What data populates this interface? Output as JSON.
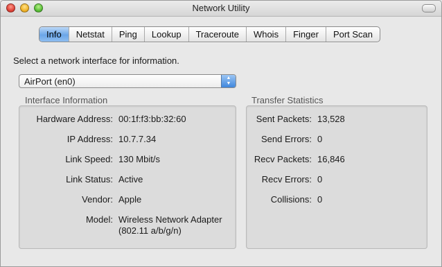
{
  "window": {
    "title": "Network Utility"
  },
  "tabs": [
    {
      "label": "Info",
      "active": true
    },
    {
      "label": "Netstat",
      "active": false
    },
    {
      "label": "Ping",
      "active": false
    },
    {
      "label": "Lookup",
      "active": false
    },
    {
      "label": "Traceroute",
      "active": false
    },
    {
      "label": "Whois",
      "active": false
    },
    {
      "label": "Finger",
      "active": false
    },
    {
      "label": "Port Scan",
      "active": false
    }
  ],
  "info": {
    "prompt": "Select a network interface for information.",
    "interface_select": {
      "value": "AirPort (en0)"
    },
    "interface_info": {
      "title": "Interface Information",
      "rows": [
        {
          "label": "Hardware Address:",
          "value": "00:1f:f3:bb:32:60"
        },
        {
          "label": "IP Address:",
          "value": "10.7.7.34"
        },
        {
          "label": "Link Speed:",
          "value": "130 Mbit/s"
        },
        {
          "label": "Link Status:",
          "value": "Active"
        },
        {
          "label": "Vendor:",
          "value": "Apple"
        },
        {
          "label": "Model:",
          "value": "Wireless Network Adapter",
          "value2": "(802.11 a/b/g/n)"
        }
      ]
    },
    "transfer_stats": {
      "title": "Transfer Statistics",
      "rows": [
        {
          "label": "Sent Packets:",
          "value": "13,528"
        },
        {
          "label": "Send Errors:",
          "value": "0"
        },
        {
          "label": "Recv Packets:",
          "value": "16,846"
        },
        {
          "label": "Recv Errors:",
          "value": "0"
        },
        {
          "label": "Collisions:",
          "value": "0"
        }
      ]
    }
  },
  "colors": {
    "active_tab": "#6aa6e8",
    "popup_arrows": "#3f86dc"
  }
}
